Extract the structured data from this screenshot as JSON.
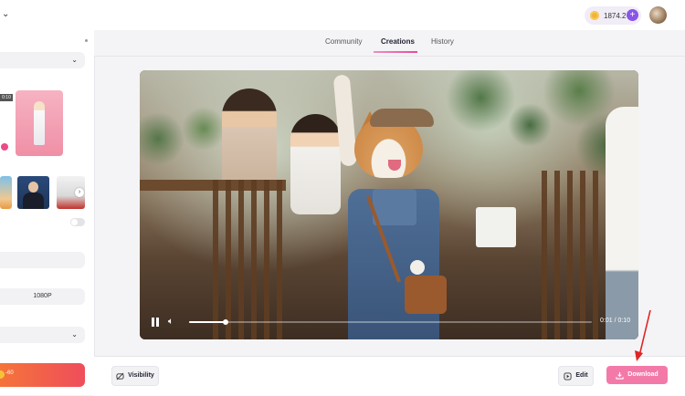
{
  "header": {
    "credits": "1874.2",
    "plus_icon": "plus-icon",
    "avatar_icon": "avatar-icon"
  },
  "tabs": [
    {
      "label": "Community",
      "active": false
    },
    {
      "label": "Creations",
      "active": true
    },
    {
      "label": "History",
      "active": false
    }
  ],
  "left_panel": {
    "thumb_duration": "0:10",
    "resolution": "1080P",
    "cost": "-60"
  },
  "video": {
    "time": "0:01 / 0:10",
    "progress_fraction": 0.09
  },
  "actions": {
    "visibility_label": "Visibility",
    "edit_label": "Edit",
    "download_label": "Download"
  },
  "colors": {
    "accent": "#ec4899",
    "download_bg": "#f37aa8",
    "cta_gradient_start": "#f5743a",
    "cta_gradient_end": "#ef4d5b",
    "annotation_arrow": "#e02424"
  }
}
